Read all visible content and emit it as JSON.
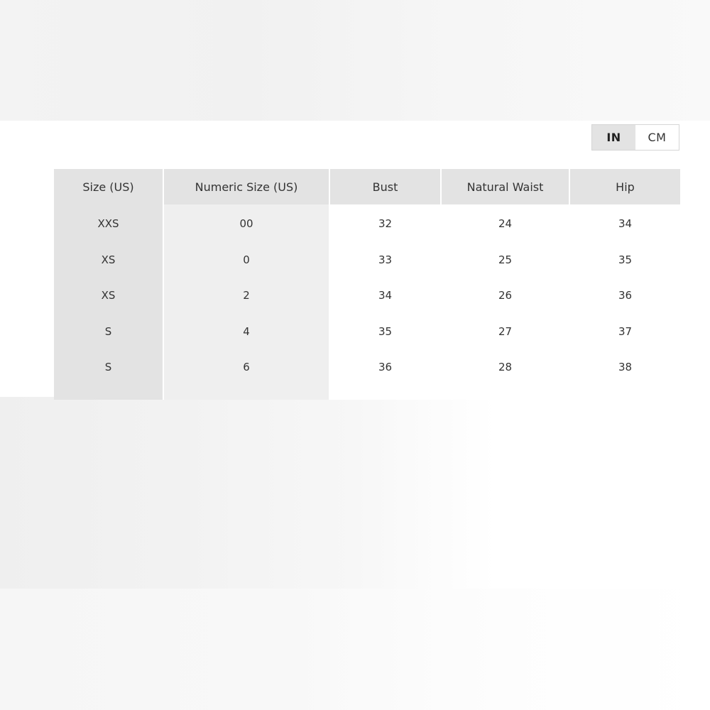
{
  "unit_toggle": {
    "options": [
      {
        "label": "IN",
        "active": true
      },
      {
        "label": "CM",
        "active": false
      }
    ]
  },
  "table": {
    "headers": [
      "Size (US)",
      "Numeric Size (US)",
      "Bust",
      "Natural Waist",
      "Hip"
    ],
    "rows": [
      [
        "XXS",
        "00",
        "32",
        "24",
        "34"
      ],
      [
        "XS",
        "0",
        "33",
        "25",
        "35"
      ],
      [
        "XS",
        "2",
        "34",
        "26",
        "36"
      ],
      [
        "S",
        "4",
        "35",
        "27",
        "37"
      ],
      [
        "S",
        "6",
        "36",
        "28",
        "38"
      ]
    ]
  },
  "colors": {
    "header_bg": "#e3e3e3",
    "size_column_bg": "#e3e3e3",
    "numeric_column_bg": "#efefef",
    "text": "#333333"
  }
}
